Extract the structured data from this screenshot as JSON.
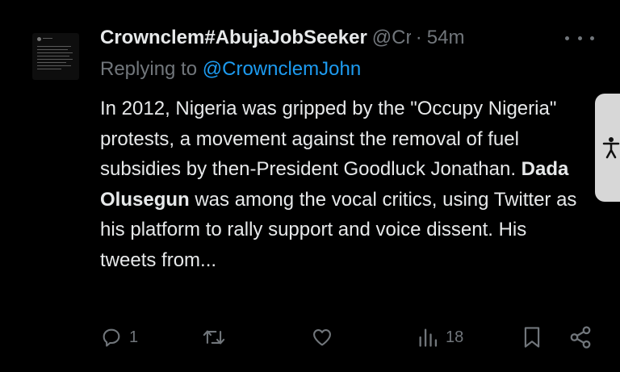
{
  "tweet": {
    "display_name": "Crownclem#AbujaJobSeeker",
    "handle": "@CrownclemJohn",
    "separator": "·",
    "time": "54m",
    "replying_prefix": "Replying to ",
    "replying_to": "@CrownclemJohn",
    "body": {
      "part1": "In 2012, Nigeria was gripped by the \"Occupy Nigeria\" protests, a movement against the removal of fuel subsidies by then-President Goodluck Jonathan. ",
      "bold": "Dada Olusegun",
      "part2": " was among the vocal critics, using Twitter as his platform to rally support and voice dissent. His tweets from..."
    }
  },
  "actions": {
    "reply_count": "1",
    "retweet_count": "",
    "like_count": "",
    "views_count": "18"
  },
  "icons": {
    "more": "more-dots-icon",
    "reply": "reply-icon",
    "retweet": "retweet-icon",
    "like": "heart-icon",
    "views": "views-bar-chart-icon",
    "bookmark": "bookmark-icon",
    "share": "share-icon",
    "accessibility": "accessibility-person-icon"
  },
  "colors": {
    "background": "#000000",
    "text": "#e7e9ea",
    "secondary": "#71767b",
    "link": "#1d9bf0",
    "accessibility_tab": "#d7d7d7"
  }
}
